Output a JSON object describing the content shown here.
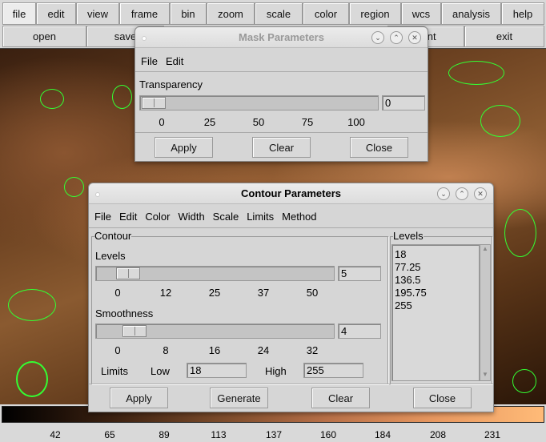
{
  "menubar": [
    "file",
    "edit",
    "view",
    "frame",
    "bin",
    "zoom",
    "scale",
    "color",
    "region",
    "wcs",
    "analysis",
    "help"
  ],
  "buttonbar": [
    "open",
    "save",
    "print",
    "exit"
  ],
  "colorbar": {
    "ticks": [
      "42",
      "65",
      "89",
      "113",
      "137",
      "160",
      "184",
      "208",
      "231"
    ]
  },
  "mask": {
    "title": "Mask Parameters",
    "menu": [
      "File",
      "Edit"
    ],
    "transparency_label": "Transparency",
    "transparency_value": "0",
    "ticks": [
      "0",
      "25",
      "50",
      "75",
      "100"
    ],
    "buttons": [
      "Apply",
      "Clear",
      "Close"
    ]
  },
  "contour": {
    "title": "Contour Parameters",
    "menu": [
      "File",
      "Edit",
      "Color",
      "Width",
      "Scale",
      "Limits",
      "Method"
    ],
    "frame_label": "Contour",
    "levels_label": "Levels",
    "levels_value": "5",
    "levels_ticks": [
      "0",
      "12",
      "25",
      "37",
      "50"
    ],
    "smooth_label": "Smoothness",
    "smooth_value": "4",
    "smooth_ticks": [
      "0",
      "8",
      "16",
      "24",
      "32"
    ],
    "limits_label": "Limits",
    "low_label": "Low",
    "low_value": "18",
    "high_label": "High",
    "high_value": "255",
    "levels_list_label": "Levels",
    "levels_list": [
      "18",
      "77.25",
      "136.5",
      "195.75",
      "255"
    ],
    "buttons": [
      "Apply",
      "Generate",
      "Clear",
      "Close"
    ]
  },
  "colors": {
    "contour": "#33ff33",
    "dialog_bg": "#d6d6d6"
  }
}
